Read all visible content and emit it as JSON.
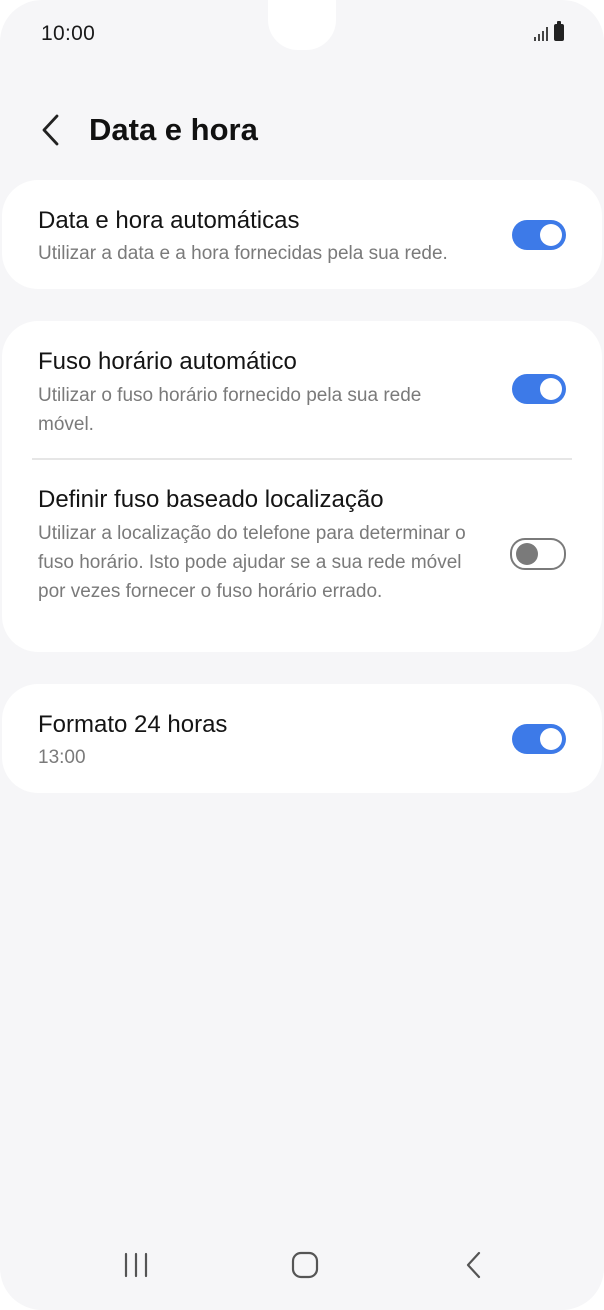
{
  "status_bar": {
    "time": "10:00"
  },
  "header": {
    "title": "Data e hora"
  },
  "settings": {
    "auto_datetime": {
      "title": "Data e hora automáticas",
      "subtitle": "Utilizar a data e a hora fornecidas pela sua rede.",
      "enabled": true
    },
    "auto_timezone": {
      "title": "Fuso horário automático",
      "subtitle": "Utilizar o fuso horário fornecido pela sua rede móvel.",
      "enabled": true
    },
    "location_timezone": {
      "title": "Definir fuso baseado localização",
      "subtitle": "Utilizar a localização do telefone para determinar o fuso horário. Isto pode ajudar se a sua rede móvel por vezes fornecer o fuso horário errado.",
      "enabled": false
    },
    "format_24h": {
      "title": "Formato 24 horas",
      "subtitle": "13:00",
      "enabled": true
    }
  },
  "colors": {
    "accent": "#3d7ae8",
    "background": "#f6f6f8",
    "card": "#ffffff"
  },
  "icons": {
    "back": "chevron-left-icon",
    "nav_recents": "recents-icon",
    "nav_home": "home-icon",
    "nav_back": "back-icon"
  }
}
